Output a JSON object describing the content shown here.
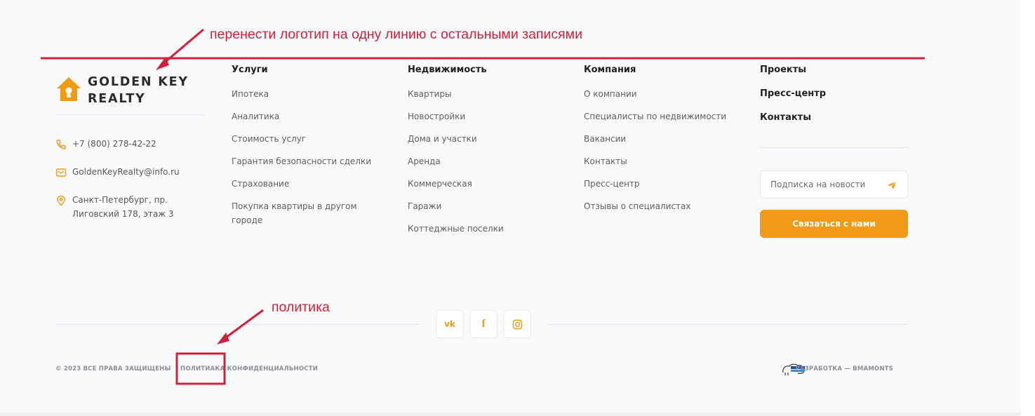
{
  "annotations": {
    "logo_note": "перенести логотип на одну линию с остальными записями",
    "policy_note": "политика"
  },
  "logo": {
    "line1": "GOLDEN KEY",
    "line2": "REALTY"
  },
  "contacts": {
    "phone": "+7 (800) 278-42-22",
    "email": "GoldenKeyRealty@info.ru",
    "address_line1": "Санкт-Петербург, пр.",
    "address_line2": "Лиговский 178, этаж 3"
  },
  "columns": {
    "services": {
      "title": "Услуги",
      "links": [
        "Ипотека",
        "Аналитика",
        "Стоимость услуг",
        "Гарантия безопасности сделки",
        "Страхование",
        "Покупка квартиры в другом городе"
      ]
    },
    "realty": {
      "title": "Недвижимость",
      "links": [
        "Квартиры",
        "Новостройки",
        "Дома и участки",
        "Аренда",
        "Коммерческая",
        "Гаражи",
        "Коттеджные поселки"
      ]
    },
    "company": {
      "title": "Компания",
      "links": [
        "О компании",
        "Специалисты по недвижимости",
        "Вакансии",
        "Контакты",
        "Пресс-центр",
        "Отзывы о специалистах"
      ]
    },
    "projects": {
      "links": [
        "Проекты",
        "Пресс-центр",
        "Контакты"
      ]
    }
  },
  "subscribe": {
    "placeholder": "Подписка на новости"
  },
  "cta_label": "Связаться с нами",
  "social": {
    "vk": "vk",
    "fb": "f",
    "ig_icon": "instagram-icon"
  },
  "bottom": {
    "copyright": "© 2023 ВСЕ ПРАВА ЗАЩИЩЕНЫ",
    "policy": "ПОЛИТИАКА КОНФИДЕНЦИАЛЬНОСТИ",
    "dev": "РАЗРАБОТКА — BMAMONTS"
  },
  "colors": {
    "accent": "#f09a15",
    "annotation": "#d3203a",
    "background": "#f8f9fb"
  }
}
